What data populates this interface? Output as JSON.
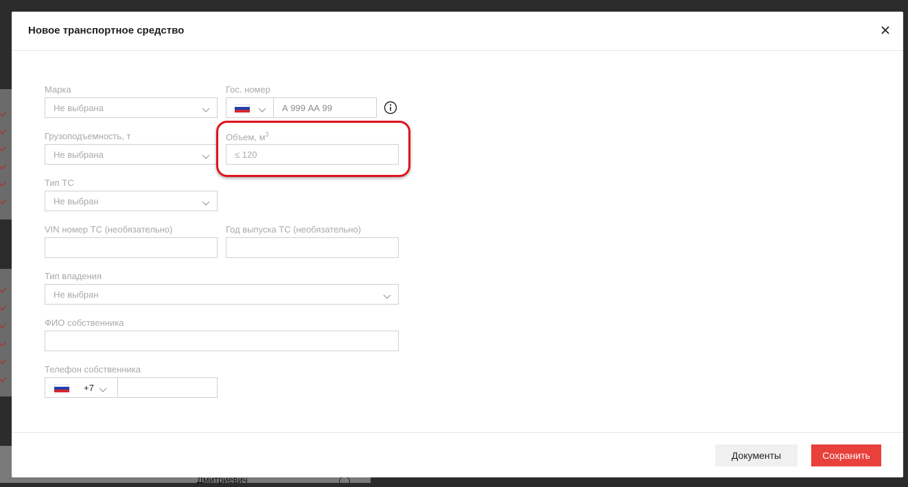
{
  "modal": {
    "title": "Новое транспортное средство"
  },
  "form": {
    "brand": {
      "label": "Марка",
      "value": "Не выбрана"
    },
    "plate": {
      "label": "Гос. номер",
      "placeholder": "А 999 АА 99"
    },
    "capacity": {
      "label": "Грузоподъемность, т",
      "value": "Не выбрана"
    },
    "volume": {
      "label": "Объем, м",
      "label_sup": "3",
      "placeholder": "≤ 120"
    },
    "vehicle_type": {
      "label": "Тип ТС",
      "value": "Не выбран"
    },
    "vin": {
      "label": "VIN номер ТС (необязательно)",
      "value": ""
    },
    "year": {
      "label": "Год выпуска ТС (необязательно)",
      "value": ""
    },
    "ownership": {
      "label": "Тип владения",
      "value": "Не выбран"
    },
    "owner_name": {
      "label": "ФИО собственника",
      "value": ""
    },
    "owner_phone": {
      "label": "Телефон собственника",
      "code": "+7",
      "value": ""
    }
  },
  "footer": {
    "documents_label": "Документы",
    "save_label": "Сохранить"
  },
  "background": {
    "visible_name": "Дмитриевич"
  },
  "colors": {
    "accent": "#e8403b",
    "highlight": "#e0101a"
  }
}
